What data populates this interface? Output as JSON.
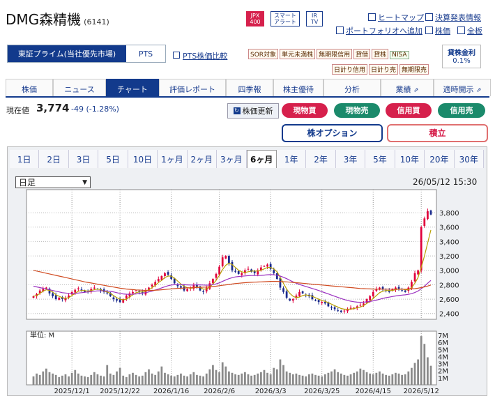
{
  "header": {
    "company": "DMG森精機",
    "code": "(6141)",
    "badges": [
      {
        "line1": "JPX",
        "line2": "400"
      },
      {
        "line1": "スマート",
        "line2": "アラート"
      },
      {
        "line1": "IR",
        "line2": "TV"
      }
    ],
    "links": [
      "ヒートマップ",
      "決算発表情報",
      "ポートフォリオへ追加",
      "株価",
      "全板"
    ]
  },
  "market": {
    "primary": "東証プライム(当社優先市場)",
    "pts": "PTS",
    "pts_compare": "PTS株価比較",
    "tags_row1": [
      "SOR対象",
      "単元未満株",
      "無期限信用",
      "貸借",
      "貸株",
      "NISA"
    ],
    "tags_row2": [
      "日計り信用",
      "日計り売",
      "無期限売"
    ],
    "loan_rate_label": "貸株金利",
    "loan_rate": "0.1%"
  },
  "nav": {
    "tabs": [
      "株価",
      "ニュース",
      "チャート",
      "評価レポート",
      "四季報",
      "株主優待",
      "分析",
      "業績",
      "適時開示"
    ],
    "active": "チャート"
  },
  "quote": {
    "label": "現在値",
    "price": "3,774",
    "change": "-49 (-1.28%)",
    "refresh": "株価更新"
  },
  "actions": {
    "buy": "現物買",
    "sell": "現物売",
    "margin_buy": "信用買",
    "margin_sell": "信用売",
    "options": "株オプション",
    "accumulate": "積立"
  },
  "colors": {
    "navy": "#123a8c",
    "red": "#d6204c",
    "teal": "#1b8a6b",
    "up": "#e0003c",
    "down": "#1a2a8c",
    "ma_short": "#b8a000",
    "ma_mid": "#9b30c0",
    "ma_long": "#d04a20"
  },
  "periods": [
    "1日",
    "2日",
    "3日",
    "5日",
    "10日",
    "1ヶ月",
    "2ヶ月",
    "3ヶ月",
    "6ヶ月",
    "1年",
    "2年",
    "3年",
    "5年",
    "10年",
    "20年",
    "30年"
  ],
  "active_period": "6ヶ月",
  "chart_type": {
    "selected": "日足"
  },
  "timestamp": "26/05/12 15:30",
  "volume_unit": "単位: M",
  "chart_data": {
    "type": "candlestick",
    "price_axis": {
      "ticks": [
        3800,
        3600,
        3400,
        3200,
        3000,
        2800,
        2600,
        2400
      ],
      "labels": [
        "3,800",
        "3,600",
        "3,400",
        "3,200",
        "3,000",
        "2,800",
        "2,600",
        "2,400"
      ],
      "ylim": [
        2320,
        4120
      ]
    },
    "volume_axis": {
      "ticks": [
        7,
        6,
        5,
        4,
        3,
        2,
        1
      ],
      "labels": [
        "7M",
        "6M",
        "5M",
        "4M",
        "3M",
        "2M",
        "1M"
      ],
      "ylim": [
        0,
        7.6
      ]
    },
    "x_labels": [
      "2025/12/1",
      "2025/12/22",
      "2026/1/16",
      "2026/2/6",
      "2026/3/3",
      "2026/3/25",
      "2026/4/15",
      "2026/5/12"
    ],
    "closes": [
      2640,
      2670,
      2720,
      2740,
      2760,
      2680,
      2640,
      2600,
      2620,
      2600,
      2620,
      2650,
      2700,
      2730,
      2750,
      2720,
      2700,
      2710,
      2740,
      2760,
      2740,
      2720,
      2700,
      2680,
      2640,
      2600,
      2580,
      2560,
      2600,
      2650,
      2680,
      2700,
      2720,
      2700,
      2680,
      2720,
      2760,
      2800,
      2840,
      2880,
      2920,
      2960,
      2940,
      2880,
      2820,
      2780,
      2760,
      2720,
      2740,
      2760,
      2800,
      2760,
      2720,
      2700,
      2760,
      2820,
      2880,
      2950,
      3050,
      3180,
      3200,
      3100,
      3000,
      2980,
      2950,
      2960,
      3000,
      3020,
      2980,
      2960,
      3000,
      3040,
      3060,
      3080,
      3020,
      2960,
      2880,
      2760,
      2700,
      2620,
      2580,
      2600,
      2650,
      2700,
      2680,
      2660,
      2640,
      2600,
      2580,
      2560,
      2560,
      2540,
      2500,
      2480,
      2460,
      2440,
      2420,
      2440,
      2460,
      2480,
      2480,
      2500,
      2520,
      2540,
      2600,
      2640,
      2700,
      2740,
      2760,
      2740,
      2720,
      2700,
      2740,
      2760,
      2740,
      2720,
      2700,
      2760,
      2840,
      2960,
      3000,
      3600,
      3720,
      3823,
      3774
    ],
    "ma_short": [
      2640,
      2650,
      2680,
      2710,
      2730,
      2720,
      2700,
      2660,
      2640,
      2620,
      2610,
      2620,
      2650,
      2680,
      2710,
      2720,
      2720,
      2710,
      2720,
      2730,
      2740,
      2730,
      2710,
      2700,
      2680,
      2650,
      2620,
      2600,
      2590,
      2600,
      2630,
      2660,
      2690,
      2700,
      2700,
      2710,
      2730,
      2760,
      2790,
      2830,
      2860,
      2900,
      2920,
      2920,
      2890,
      2850,
      2810,
      2780,
      2760,
      2750,
      2760,
      2770,
      2760,
      2740,
      2740,
      2770,
      2810,
      2860,
      2930,
      3010,
      3070,
      3100,
      3080,
      3040,
      3000,
      2980,
      2970,
      2980,
      2990,
      2990,
      2990,
      3000,
      3020,
      3040,
      3040,
      3020,
      2980,
      2900,
      2820,
      2740,
      2680,
      2640,
      2620,
      2630,
      2650,
      2660,
      2650,
      2640,
      2620,
      2600,
      2580,
      2570,
      2550,
      2530,
      2510,
      2490,
      2470,
      2460,
      2460,
      2460,
      2470,
      2480,
      2490,
      2510,
      2540,
      2570,
      2610,
      2650,
      2690,
      2710,
      2720,
      2720,
      2720,
      2730,
      2740,
      2740,
      2730,
      2730,
      2760,
      2820,
      2900,
      3040,
      3200,
      3380,
      3560
    ],
    "ma_mid": [
      2780,
      2770,
      2760,
      2750,
      2740,
      2730,
      2720,
      2710,
      2700,
      2690,
      2685,
      2680,
      2680,
      2680,
      2685,
      2690,
      2695,
      2700,
      2705,
      2710,
      2715,
      2715,
      2715,
      2712,
      2708,
      2700,
      2690,
      2680,
      2672,
      2668,
      2665,
      2668,
      2672,
      2678,
      2684,
      2690,
      2700,
      2712,
      2726,
      2740,
      2756,
      2772,
      2786,
      2796,
      2800,
      2802,
      2802,
      2800,
      2798,
      2796,
      2796,
      2798,
      2798,
      2796,
      2794,
      2796,
      2802,
      2812,
      2826,
      2846,
      2866,
      2884,
      2898,
      2908,
      2914,
      2918,
      2922,
      2926,
      2928,
      2928,
      2928,
      2930,
      2934,
      2938,
      2940,
      2938,
      2932,
      2920,
      2904,
      2884,
      2862,
      2840,
      2820,
      2804,
      2790,
      2776,
      2762,
      2748,
      2734,
      2720,
      2704,
      2688,
      2672,
      2656,
      2640,
      2624,
      2608,
      2594,
      2582,
      2572,
      2564,
      2558,
      2556,
      2558,
      2562,
      2568,
      2576,
      2586,
      2598,
      2610,
      2620,
      2628,
      2636,
      2644,
      2650,
      2656,
      2660,
      2666,
      2676,
      2692,
      2712,
      2744,
      2780,
      2820,
      2860
    ],
    "ma_long": [
      3000,
      2990,
      2980,
      2970,
      2960,
      2950,
      2940,
      2930,
      2920,
      2910,
      2900,
      2890,
      2880,
      2870,
      2860,
      2850,
      2840,
      2832,
      2824,
      2816,
      2808,
      2800,
      2792,
      2784,
      2776,
      2768,
      2760,
      2752,
      2746,
      2740,
      2736,
      2732,
      2728,
      2726,
      2724,
      2722,
      2722,
      2722,
      2724,
      2726,
      2730,
      2734,
      2738,
      2742,
      2746,
      2750,
      2752,
      2754,
      2756,
      2758,
      2760,
      2762,
      2764,
      2766,
      2768,
      2772,
      2776,
      2780,
      2786,
      2792,
      2798,
      2804,
      2810,
      2816,
      2820,
      2824,
      2828,
      2832,
      2834,
      2836,
      2838,
      2840,
      2842,
      2844,
      2846,
      2846,
      2846,
      2844,
      2842,
      2840,
      2836,
      2832,
      2828,
      2824,
      2820,
      2816,
      2812,
      2808,
      2804,
      2800,
      2796,
      2792,
      2788,
      2784,
      2780,
      2776,
      2772,
      2768,
      2764,
      2760,
      2756,
      2752,
      2748,
      2746,
      2744,
      2742,
      2740,
      2738,
      2738,
      2738,
      2738,
      2738,
      2738,
      2738,
      2738,
      2738,
      2738,
      2740,
      2742,
      2746,
      2752,
      2760,
      2770,
      2782,
      2796
    ],
    "volumes": [
      1.2,
      1.6,
      1.4,
      1.9,
      2.3,
      1.8,
      1.6,
      1.4,
      1.1,
      1.3,
      1.5,
      1.2,
      1.7,
      2.1,
      1.6,
      1.3,
      1.2,
      1.1,
      1.4,
      1.8,
      1.5,
      1.3,
      1.2,
      2.8,
      1.6,
      1.4,
      1.9,
      2.4,
      1.3,
      1.1,
      1.5,
      1.7,
      1.4,
      1.2,
      1.3,
      1.8,
      2.2,
      1.6,
      1.4,
      1.9,
      2.6,
      1.7,
      1.5,
      1.3,
      1.2,
      1.4,
      1.6,
      1.3,
      1.2,
      1.5,
      1.8,
      1.4,
      1.3,
      1.2,
      1.6,
      2.2,
      2.8,
      2.1,
      1.8,
      3.2,
      2.6,
      1.9,
      1.7,
      1.5,
      1.4,
      1.6,
      1.8,
      1.5,
      1.3,
      1.4,
      1.6,
      1.8,
      2.1,
      1.7,
      1.5,
      2.4,
      2.2,
      3.6,
      2.8,
      1.9,
      1.7,
      1.5,
      1.6,
      1.4,
      1.3,
      1.2,
      1.5,
      1.6,
      1.4,
      1.3,
      1.2,
      1.5,
      1.7,
      1.9,
      2.2,
      1.8,
      1.6,
      1.4,
      1.3,
      1.5,
      1.7,
      1.9,
      2.3,
      2.1,
      1.8,
      1.6,
      1.5,
      1.7,
      1.9,
      1.6,
      1.4,
      1.3,
      1.5,
      1.7,
      1.6,
      1.4,
      1.5,
      1.9,
      2.4,
      3.1,
      3.6,
      6.9,
      5.8,
      3.9,
      2.7
    ]
  }
}
